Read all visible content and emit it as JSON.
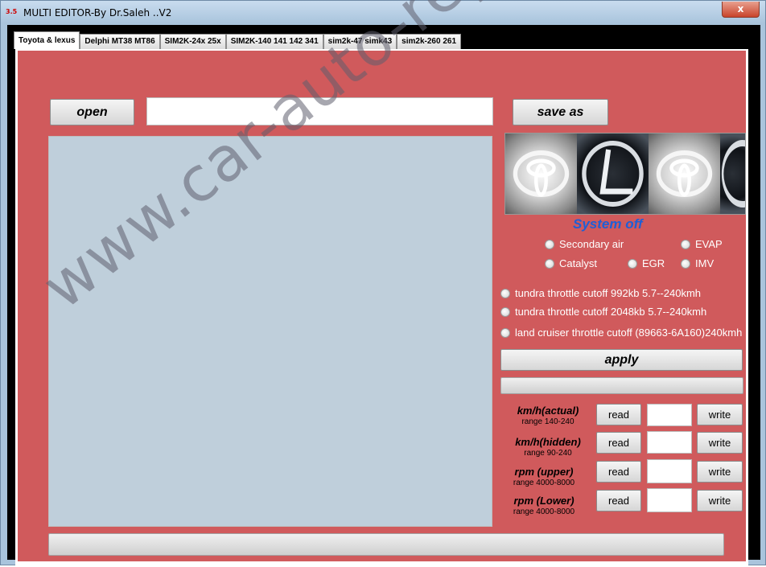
{
  "window": {
    "title": "MULTI EDITOR-By Dr.Saleh ..V2",
    "icon_text": "3.5",
    "close_symbol": "x"
  },
  "tabs": [
    {
      "label": "Toyota & lexus",
      "active": true
    },
    {
      "label": "Delphi MT38 MT86",
      "active": false
    },
    {
      "label": "SIM2K-24x 25x",
      "active": false
    },
    {
      "label": "SIM2K-140 141 142 341",
      "active": false
    },
    {
      "label": "sim2k-47 simk43",
      "active": false
    },
    {
      "label": "sim2k-260 261",
      "active": false
    }
  ],
  "toolbar": {
    "open_label": "open",
    "save_label": "save as",
    "path_value": ""
  },
  "logos": [
    "toyota-logo",
    "lexus-logo",
    "toyota-logo",
    "lexus-logo"
  ],
  "status": {
    "text": "System off",
    "color": "#1e5fd6"
  },
  "systems": {
    "secondary_air": "Secondary air",
    "evap": "EVAP",
    "catalyst": "Catalyst",
    "egr": "EGR",
    "imv": "IMV"
  },
  "throttle_options": [
    "tundra throttle cutoff 992kb 5.7--240kmh",
    "tundra throttle cutoff 2048kb 5.7--240kmh",
    "land cruiser throttle cutoff (89663-6A160)240kmh"
  ],
  "apply_label": "apply",
  "params": [
    {
      "title": "km/h(actual)",
      "range": "range 140-240",
      "read": "read",
      "value": "",
      "write": "write"
    },
    {
      "title": "km/h(hidden)",
      "range": "range 90-240",
      "read": "read",
      "value": "",
      "write": "write"
    },
    {
      "title": "rpm (upper)",
      "range": "range 4000-8000",
      "read": "read",
      "value": "",
      "write": "write"
    },
    {
      "title": "rpm (Lower)",
      "range": "range 4000-8000",
      "read": "read",
      "value": "",
      "write": "write"
    }
  ],
  "watermark": "www.car-auto-repair.com",
  "colors": {
    "panel_bg": "#d05a5c",
    "editor_bg": "#bfcfdb"
  }
}
